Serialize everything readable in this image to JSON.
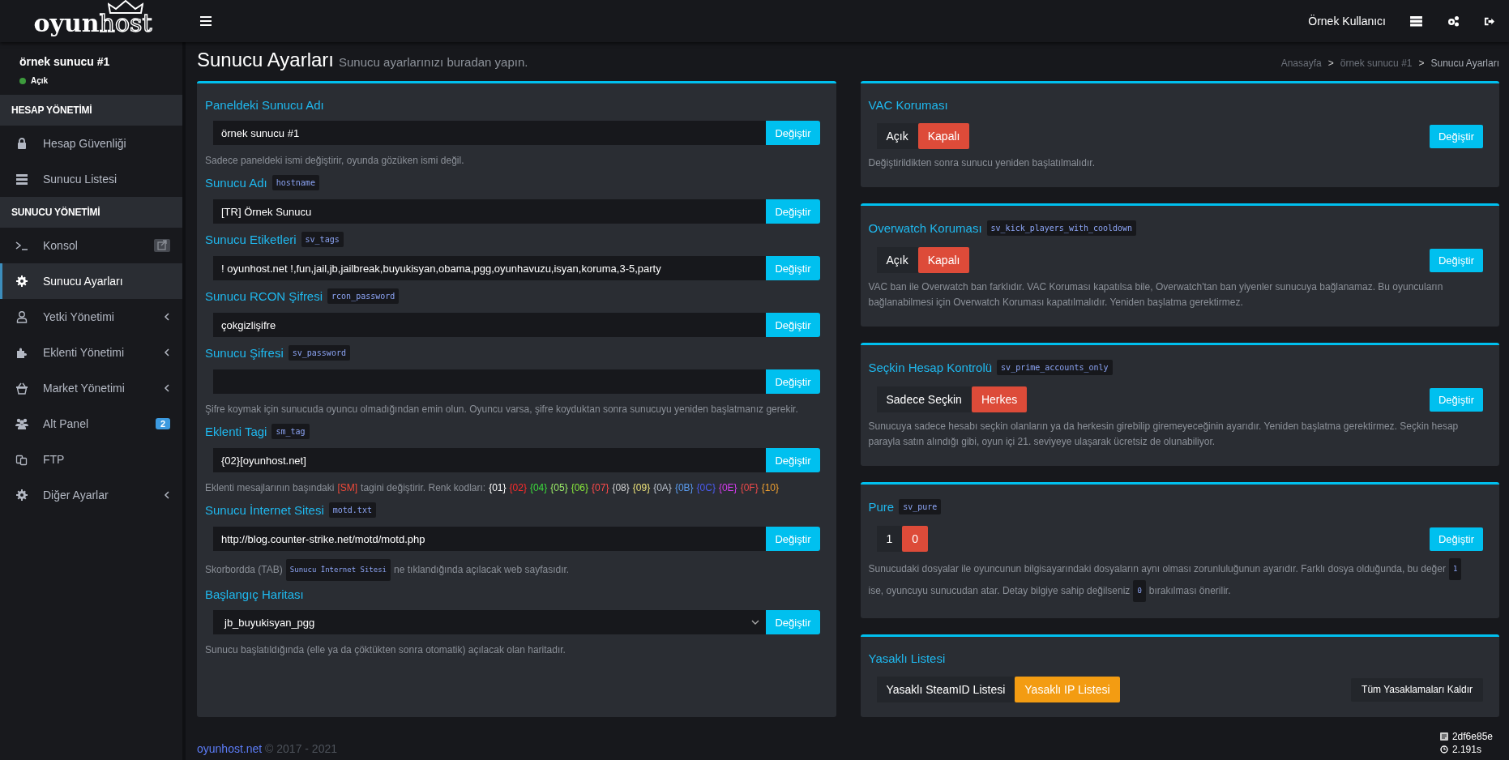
{
  "logo": {
    "parts": [
      "oyun",
      "host"
    ]
  },
  "topbar": {
    "user": "Örnek Kullanıcı"
  },
  "server": {
    "name": "örnek sunucu #1",
    "status": "Açık",
    "color": "#3d9b3d"
  },
  "sidebar": {
    "sections": [
      {
        "heading": "HESAP YÖNETİMİ",
        "items": [
          {
            "label": "Hesap Güvenliği",
            "selected": false,
            "expandable": false
          },
          {
            "label": "Sunucu Listesi",
            "selected": false,
            "expandable": false
          }
        ]
      },
      {
        "heading": "SUNUCU YÖNETİMİ",
        "items": [
          {
            "label": "Konsol",
            "selected": false,
            "expandable": false,
            "external": true
          },
          {
            "label": "Sunucu Ayarları",
            "selected": true,
            "expandable": false
          },
          {
            "label": "Yetki Yönetimi",
            "selected": false,
            "expandable": true
          },
          {
            "label": "Eklenti Yönetimi",
            "selected": false,
            "expandable": true
          },
          {
            "label": "Market Yönetimi",
            "selected": false,
            "expandable": true
          },
          {
            "label": "Alt Panel",
            "selected": false,
            "expandable": false,
            "badge": "2"
          },
          {
            "label": "FTP",
            "selected": false,
            "expandable": false
          },
          {
            "label": "Diğer Ayarlar",
            "selected": false,
            "expandable": true
          }
        ]
      }
    ]
  },
  "page": {
    "title": "Sunucu Ayarları",
    "subtitle": "Sunucu ayarlarınızı buradan yapın.",
    "breadcrumb": [
      "Anasayfa",
      "örnek sunucu #1",
      "Sunucu Ayarları"
    ],
    "separator": ">"
  },
  "settings": [
    {
      "label": "Paneldeki Sunucu Adı",
      "kind": "text",
      "value": "örnek sunucu #1",
      "button": "Değiştir",
      "help": "Sadece paneldeki ismi değiştirir, oyunda gözüken ismi değil."
    },
    {
      "label": "Sunucu Adı",
      "code": "hostname",
      "kind": "text",
      "value": "[TR] Örnek Sunucu",
      "button": "Değiştir"
    },
    {
      "label": "Sunucu Etiketleri",
      "code": "sv_tags",
      "kind": "text",
      "value": "! oyunhost.net !,fun,jail,jb,jailbreak,buyukisyan,obama,pgg,oyunhavuzu,isyan,koruma,3-5,party",
      "button": "Değiştir"
    },
    {
      "label": "Sunucu RCON Şifresi",
      "code": "rcon_password",
      "kind": "text",
      "value": "çokgizlişifre",
      "button": "Değiştir"
    },
    {
      "label": "Sunucu Şifresi",
      "code": "sv_password",
      "kind": "text",
      "button": "Değiştir",
      "help": "Şifre koymak için sunucuda oyuncu olmadığından emin olun. Oyuncu varsa, şifre koyduktan sonra sunucuyu yeniden başlatmanız gerekir."
    },
    {
      "label": "Eklenti Tagi",
      "code": "sm_tag",
      "kind": "text",
      "value": "{02}[oyunhost.net]",
      "button": "Değiştir",
      "help": [
        {
          "kind": "plain",
          "text": "Eklenti mesajlarının başındaki"
        },
        {
          "kind": "colored",
          "text": "[SM]",
          "color": "#f04a3a"
        },
        {
          "kind": "plain",
          "text": "tagini değiştirir. Renk kodları:"
        },
        {
          "kind": "colored",
          "text": "{01}",
          "color": "#ffffff"
        },
        {
          "kind": "colored",
          "text": "{02}",
          "color": "#ff2b2b"
        },
        {
          "kind": "colored",
          "text": "{04}",
          "color": "#3cdc3c"
        },
        {
          "kind": "colored",
          "text": "{05}",
          "color": "#9ef06a"
        },
        {
          "kind": "colored",
          "text": "{06}",
          "color": "#88e83c"
        },
        {
          "kind": "colored",
          "text": "{07}",
          "color": "#ff4a4a"
        },
        {
          "kind": "colored",
          "text": "{08}",
          "color": "#d0d0d0"
        },
        {
          "kind": "colored",
          "text": "{09}",
          "color": "#ece27a"
        },
        {
          "kind": "colored",
          "text": "{0A}",
          "color": "#b8c0cc"
        },
        {
          "kind": "colored",
          "text": "{0B}",
          "color": "#5a9cf0"
        },
        {
          "kind": "colored",
          "text": "{0C}",
          "color": "#4a5cf2"
        },
        {
          "kind": "colored",
          "text": "{0E}",
          "color": "#d63cf0"
        },
        {
          "kind": "colored",
          "text": "{0F}",
          "color": "#f04a4a"
        },
        {
          "kind": "colored",
          "text": "{10}",
          "color": "#f0a030"
        }
      ]
    },
    {
      "label": "Sunucu İnternet Sitesi",
      "code": "motd.txt",
      "kind": "text",
      "value": "http://blog.counter-strike.net/motd/motd.php",
      "button": "Değiştir",
      "help": [
        {
          "kind": "plain",
          "text": "Skorbordda (TAB)"
        },
        {
          "kind": "code",
          "text": "Sunucu İnternet Sitesi"
        },
        {
          "kind": "plain",
          "text": "ne tıklandığında açılacak web sayfasıdır."
        }
      ]
    },
    {
      "label": "Başlangıç Haritası",
      "kind": "select",
      "value": "jb_buyukisyan_pgg",
      "button": "Değiştir",
      "help": "Sunucu başlatıldığında (elle ya da çöktükten sonra otomatik) açılacak olan haritadır."
    }
  ],
  "cards": [
    {
      "title": "VAC Koruması",
      "kind": "toggle",
      "options": [
        {
          "label": "Açık",
          "selected": false
        },
        {
          "label": "Kapalı",
          "selected": true
        }
      ],
      "button": "Değiştir",
      "help": "Değiştirildikten sonra sunucu yeniden başlatılmalıdır."
    },
    {
      "title": "Overwatch Koruması",
      "code": "sv_kick_players_with_cooldown",
      "kind": "toggle",
      "options": [
        {
          "label": "Açık",
          "selected": false
        },
        {
          "label": "Kapalı",
          "selected": true
        }
      ],
      "button": "Değiştir",
      "help": "VAC ban ile Overwatch ban farklıdır. VAC Koruması kapatılsa bile, Overwatch'tan ban yiyenler sunucuya bağlanamaz. Bu oyuncuların bağlanabilmesi için Overwatch Koruması kapatılmalıdır. Yeniden başlatma gerektirmez."
    },
    {
      "title": "Seçkin Hesap Kontrolü",
      "code": "sv_prime_accounts_only",
      "kind": "toggle",
      "options": [
        {
          "label": "Sadece Seçkin",
          "selected": false
        },
        {
          "label": "Herkes",
          "selected": true
        }
      ],
      "button": "Değiştir",
      "help": "Sunucuya sadece hesabı seçkin olanların ya da herkesin girebilip giremeyeceğinin ayarıdır. Yeniden başlatma gerektirmez. Seçkin hesap parayla satın alındığı gibi, oyun içi 21. seviyeye ulaşarak ücretsiz de olunabiliyor."
    },
    {
      "title": "Pure",
      "code": "sv_pure",
      "kind": "toggle",
      "options": [
        {
          "label": "1",
          "selected": false
        },
        {
          "label": "0",
          "selected": true
        }
      ],
      "button": "Değiştir",
      "help": [
        {
          "kind": "plain",
          "text": "Sunucudaki dosyalar ile oyuncunun bilgisayarındaki dosyaların aynı olması zorunluluğunun ayarıdır. Farklı dosya olduğunda, bu değer"
        },
        {
          "kind": "code",
          "text": "1"
        },
        {
          "kind": "plain",
          "text": "ise, oyuncuyu sunucudan atar. Detay bilgiye sahip değilseniz"
        },
        {
          "kind": "code",
          "text": "0"
        },
        {
          "kind": "plain",
          "text": "bırakılması önerilir."
        }
      ]
    },
    {
      "title": "Yasaklı Listesi",
      "kind": "tabs",
      "options": [
        {
          "label": "Yasaklı SteamID Listesi",
          "selected": false
        },
        {
          "label": "Yasaklı IP Listesi",
          "selected": true
        }
      ],
      "button": "Tüm Yasaklamaları Kaldır"
    }
  ],
  "footer": {
    "link": "oyunhost.net",
    "copyright": "© 2017 - 2021",
    "version": "2df6e85e",
    "time": "2.191s"
  }
}
